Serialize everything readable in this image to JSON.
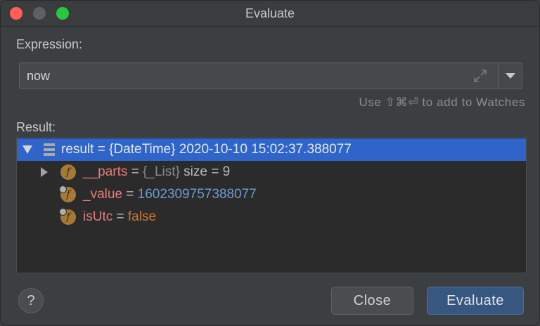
{
  "window": {
    "title": "Evaluate"
  },
  "expression": {
    "label": "Expression:",
    "value": "now",
    "hint": "Use ⇧⌘⏎ to add to Watches"
  },
  "result": {
    "label": "Result:",
    "rows": [
      {
        "name": "result",
        "eq": " = ",
        "value": "{DateTime} 2020-10-10 15:02:37.388077"
      },
      {
        "name": "__parts",
        "eq": " = ",
        "type": "{_List}",
        "value": " size = 9"
      },
      {
        "name": "_value",
        "eq": " = ",
        "value": "1602309757388077"
      },
      {
        "name": "isUtc",
        "eq": " = ",
        "value": "false"
      }
    ]
  },
  "buttons": {
    "help": "?",
    "close": "Close",
    "evaluate": "Evaluate"
  },
  "colors": {
    "selection": "#2f65ca",
    "field_name": "#e47d77",
    "number": "#6c9cd2",
    "keyword": "#cc7832",
    "field_icon": "#a57a35"
  }
}
